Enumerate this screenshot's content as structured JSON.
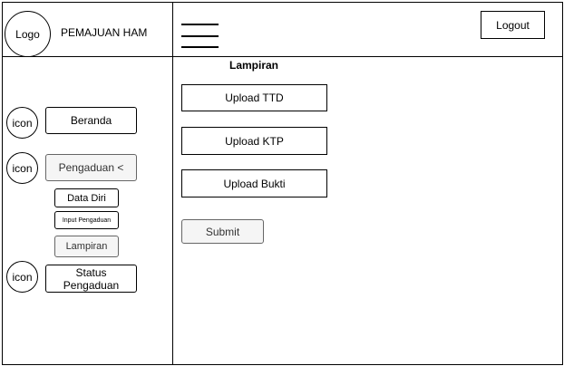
{
  "header": {
    "logo": "Logo",
    "app_title": "PEMAJUAN HAM",
    "logout_label": "Logout"
  },
  "sidebar": {
    "items": [
      {
        "icon": "icon",
        "label": "Beranda"
      },
      {
        "icon": "icon",
        "label": "Pengaduan <"
      },
      {
        "icon": "icon",
        "label": "Status Pengaduan"
      }
    ],
    "submenu": [
      {
        "label": "Data Diri"
      },
      {
        "label": "Input Pengaduan"
      },
      {
        "label": "Lampiran"
      }
    ]
  },
  "main": {
    "title": "Lampiran",
    "upload_ttd": "Upload TTD",
    "upload_ktp": "Upload KTP",
    "upload_bukti": "Upload Bukti",
    "submit": "Submit"
  }
}
